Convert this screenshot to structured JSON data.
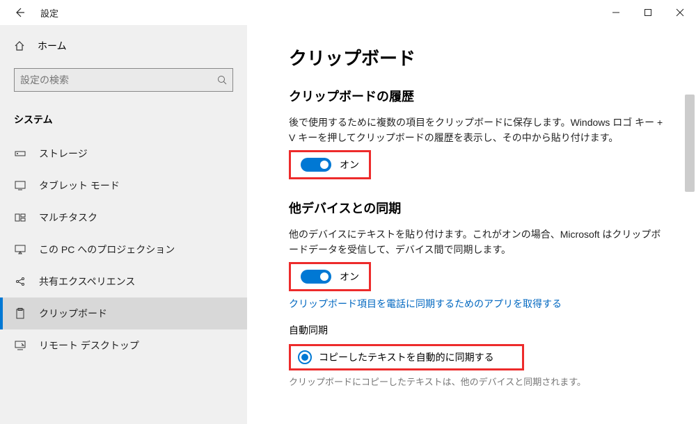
{
  "titlebar": {
    "title": "設定"
  },
  "sidebar": {
    "home": "ホーム",
    "search_placeholder": "設定の検索",
    "section": "システム",
    "items": [
      {
        "label": "ストレージ"
      },
      {
        "label": "タブレット モード"
      },
      {
        "label": "マルチタスク"
      },
      {
        "label": "この PC へのプロジェクション"
      },
      {
        "label": "共有エクスペリエンス"
      },
      {
        "label": "クリップボード"
      },
      {
        "label": "リモート デスクトップ"
      }
    ]
  },
  "content": {
    "heading": "クリップボード",
    "history": {
      "title": "クリップボードの履歴",
      "desc": "後で使用するために複数の項目をクリップボードに保存します。Windows ロゴ キー + V キーを押してクリップボードの履歴を表示し、その中から貼り付けます。",
      "toggle_label": "オン"
    },
    "sync": {
      "title": "他デバイスとの同期",
      "desc": "他のデバイスにテキストを貼り付けます。これがオンの場合、Microsoft はクリップボードデータを受信して、デバイス間で同期します。",
      "toggle_label": "オン",
      "link": "クリップボード項目を電話に同期するためのアプリを取得する",
      "auto_label": "自動同期",
      "radio1": "コピーしたテキストを自動的に同期する",
      "hint": "クリップボードにコピーしたテキストは、他のデバイスと同期されます。"
    }
  }
}
